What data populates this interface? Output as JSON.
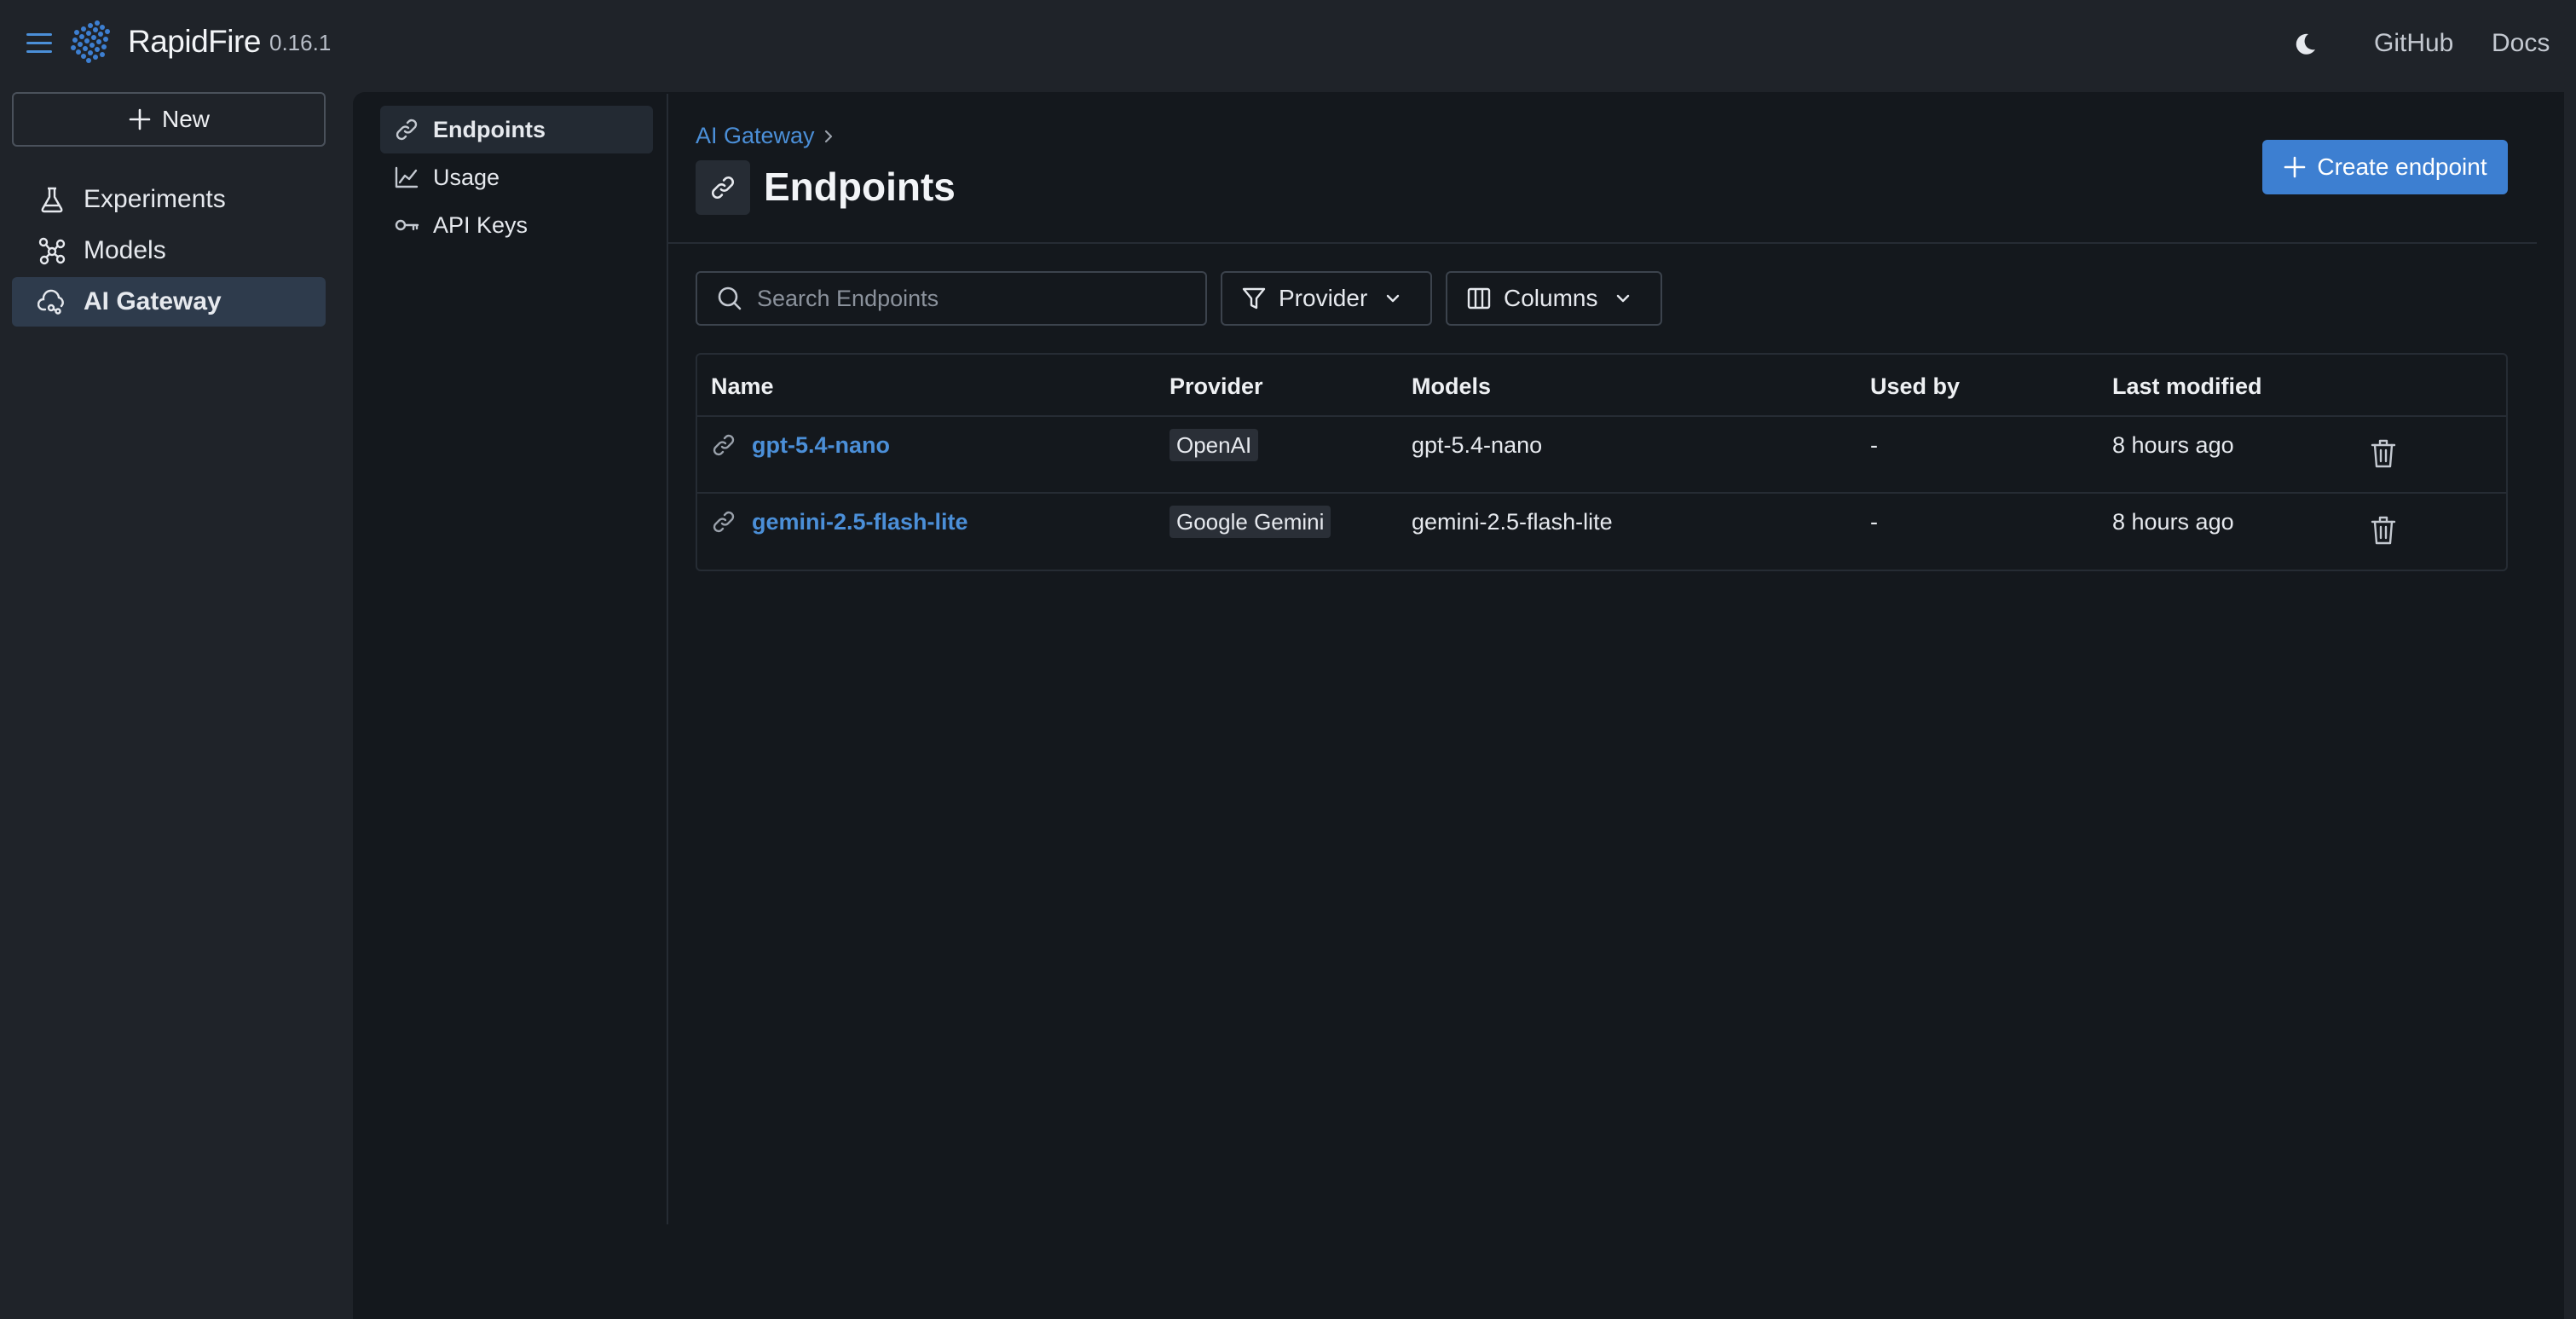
{
  "app": {
    "name": "RapidFire",
    "version": "0.16.1"
  },
  "header": {
    "theme_icon": "moon-icon",
    "links": [
      "GitHub",
      "Docs"
    ]
  },
  "sidebar": {
    "new_label": "New",
    "items": [
      {
        "label": "Experiments",
        "icon": "flask-icon"
      },
      {
        "label": "Models",
        "icon": "models-icon"
      },
      {
        "label": "AI Gateway",
        "icon": "cloud-gateway-icon",
        "active": true
      }
    ]
  },
  "subnav": {
    "items": [
      {
        "label": "Endpoints",
        "icon": "link-icon",
        "active": true
      },
      {
        "label": "Usage",
        "icon": "chart-icon"
      },
      {
        "label": "API Keys",
        "icon": "key-icon"
      }
    ]
  },
  "main": {
    "breadcrumb": "AI Gateway",
    "title": "Endpoints",
    "create_button": "Create endpoint",
    "search_placeholder": "Search Endpoints",
    "filters": {
      "provider": "Provider",
      "columns": "Columns"
    },
    "table": {
      "headers": [
        "Name",
        "Provider",
        "Models",
        "Used by",
        "Last modified"
      ],
      "rows": [
        {
          "name": "gpt-5.4-nano",
          "provider": "OpenAI",
          "models": "gpt-5.4-nano",
          "used_by": "-",
          "last_modified": "8 hours ago"
        },
        {
          "name": "gemini-2.5-flash-lite",
          "provider": "Google Gemini",
          "models": "gemini-2.5-flash-lite",
          "used_by": "-",
          "last_modified": "8 hours ago"
        }
      ]
    }
  },
  "colors": {
    "accent": "#3d7fd1",
    "link": "#4b8fd8",
    "background": "#1f2329",
    "panel": "#14181d"
  }
}
